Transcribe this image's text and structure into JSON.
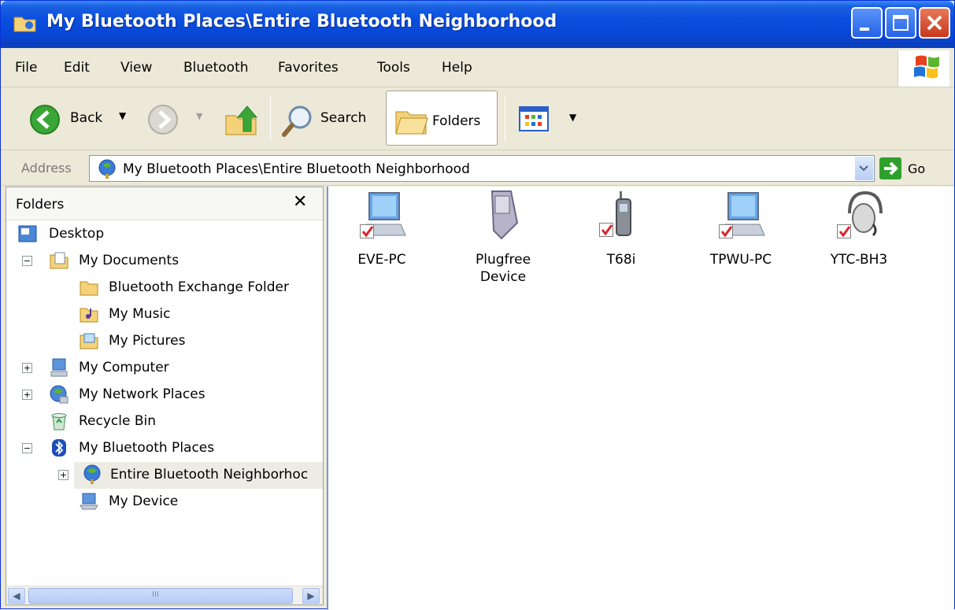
{
  "window": {
    "title": "My Bluetooth Places\\Entire Bluetooth Neighborhood"
  },
  "menu": [
    "File",
    "Edit",
    "View",
    "Bluetooth",
    "Favorites",
    "Tools",
    "Help"
  ],
  "toolbar": {
    "back_label": "Back",
    "search_label": "Search",
    "folders_label": "Folders"
  },
  "address": {
    "label": "Address",
    "value": "My Bluetooth Places\\Entire Bluetooth Neighborhood",
    "go_label": "Go"
  },
  "folders_pane": {
    "title": "Folders",
    "close_glyph": "✕",
    "tree": [
      {
        "label": "Desktop",
        "icon": "desktop-icon"
      },
      {
        "label": "My Documents",
        "icon": "my-documents-icon",
        "expander": "−"
      },
      {
        "label": "Bluetooth Exchange Folder",
        "icon": "folder-icon"
      },
      {
        "label": "My Music",
        "icon": "my-music-icon"
      },
      {
        "label": "My Pictures",
        "icon": "my-pictures-icon"
      },
      {
        "label": "My Computer",
        "icon": "my-computer-icon",
        "expander": "+"
      },
      {
        "label": "My Network Places",
        "icon": "network-places-icon",
        "expander": "+"
      },
      {
        "label": "Recycle Bin",
        "icon": "recycle-bin-icon"
      },
      {
        "label": "My Bluetooth Places",
        "icon": "bluetooth-icon",
        "expander": "−"
      },
      {
        "label": "Entire Bluetooth Neighborhoc",
        "icon": "bluetooth-neighborhood-icon",
        "expander": "+",
        "selected": true
      },
      {
        "label": "My Device",
        "icon": "my-device-icon"
      }
    ],
    "scroll_grip": "III"
  },
  "devices": [
    {
      "name": "EVE-PC",
      "icon": "computer-icon"
    },
    {
      "name": "Plugfree Device",
      "icon": "pda-icon"
    },
    {
      "name": "T68i",
      "icon": "phone-icon"
    },
    {
      "name": "TPWU-PC",
      "icon": "computer-icon"
    },
    {
      "name": "YTC-BH3",
      "icon": "headset-icon"
    }
  ],
  "colors": {
    "titlebar": "#0a4ee0",
    "window_bg": "#ece9d8",
    "selection": "#ecebe4",
    "check": "#d8252e"
  }
}
